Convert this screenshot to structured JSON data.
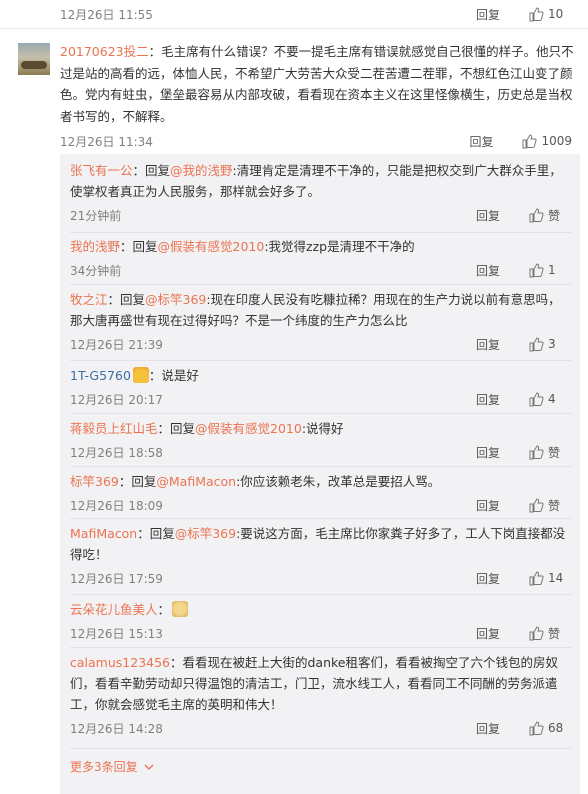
{
  "top_row": {
    "date": "12月26日 11:55",
    "reply_label": "回复",
    "likes": "10"
  },
  "main_comment": {
    "author": "20170623投二",
    "text": "：毛主席有什么错误？不要一提毛主席有错误就感觉自己很懂的样子。他只不过是站的高看的远，体恤人民，不希望广大劳苦大众受二茬苦遭二茬罪，不想红色江山变了颜色。党内有蛀虫，堡垒最容易从内部攻破，看看现在资本主义在这里怪像横生，历史总是当权者书写的，不解释。",
    "date": "12月26日 11:34",
    "reply_label": "回复",
    "likes": "1009"
  },
  "replies": [
    {
      "author": "张飞有一公",
      "mid": "：回复",
      "mention": "@我的浅野",
      "text": ":清理肯定是清理不干净的，只能是把权交到广大群众手里，使掌权者真正为人民服务，那样就会好多了。",
      "date": "21分钟前",
      "reply_label": "回复",
      "likes": "赞"
    },
    {
      "author": "我的浅野",
      "mid": "：回复",
      "mention": "@假装有感觉2010",
      "text": ":我觉得zzp是清理不干净的",
      "date": "34分钟前",
      "reply_label": "回复",
      "likes": "1"
    },
    {
      "author": "牧之江",
      "mid": "：回复",
      "mention": "@标竿369",
      "text": ":现在印度人民没有吃糠拉稀？用现在的生产力说以前有意思吗，那大唐再盛世有现在过得好吗？不是一个纬度的生产力怎么比",
      "date": "12月26日 21:39",
      "reply_label": "回复",
      "likes": "3"
    },
    {
      "author": "1T-G5760",
      "mid": "",
      "mention": "",
      "text": "：说是好",
      "date": "12月26日 20:17",
      "reply_label": "回复",
      "likes": "4"
    },
    {
      "author": "蒋毅员上红山毛",
      "mid": "：回复",
      "mention": "@假装有感觉2010",
      "text": ":说得好",
      "date": "12月26日 18:58",
      "reply_label": "回复",
      "likes": "赞"
    },
    {
      "author": "标竿369",
      "mid": "：回复",
      "mention": "@MafiMacon",
      "text": ":你应该赖老朱，改革总是要招人骂。",
      "date": "12月26日 18:09",
      "reply_label": "回复",
      "likes": "赞"
    },
    {
      "author": "MafiMacon",
      "mid": "：回复",
      "mention": "@标竿369",
      "text": ":要说这方面，毛主席比你家粪子好多了，工人下岗直接都没得吃！",
      "date": "12月26日 17:59",
      "reply_label": "回复",
      "likes": "14"
    },
    {
      "author": "云朵花儿鱼美人",
      "mid": "",
      "mention": "",
      "text": "：",
      "date": "12月26日 15:13",
      "reply_label": "回复",
      "likes": "赞"
    },
    {
      "author": "calamus123456",
      "mid": "",
      "mention": "",
      "text": "：看看现在被赶上大街的danke租客们，看看被掏空了六个钱包的房奴们，看看辛勤劳动却只得温饱的清洁工，门卫，流水线工人，看看同工不同酬的劳务派遣工，你就会感觉毛主席的英明和伟大！",
      "date": "12月26日 14:28",
      "reply_label": "回复",
      "likes": "68"
    }
  ],
  "more_replies": "更多3条回复",
  "icons": {
    "like": "thumbs-up-icon",
    "chevron": "chevron-down-icon",
    "emoji_crown": "crown-emoji-icon",
    "emoji_bear": "bear-emoji-icon"
  },
  "colors": {
    "accent": "#eb7350",
    "panel": "#f2f2f5"
  }
}
